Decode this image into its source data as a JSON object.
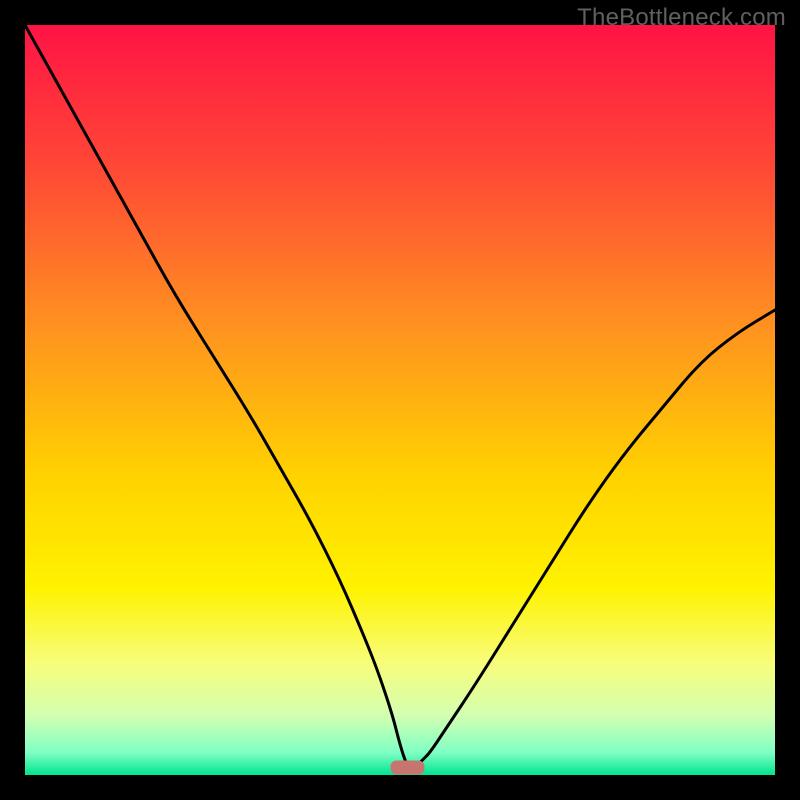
{
  "watermark": "TheBottleneck.com",
  "chart_data": {
    "type": "line",
    "title": "",
    "xlabel": "",
    "ylabel": "",
    "xlim": [
      0,
      100
    ],
    "ylim": [
      0,
      100
    ],
    "series": [
      {
        "name": "bottleneck-curve",
        "x": [
          0,
          5,
          10,
          15,
          20,
          25,
          30,
          34,
          38,
          42,
          45,
          47,
          49,
          50,
          51,
          52,
          53,
          54,
          56,
          60,
          65,
          70,
          75,
          80,
          85,
          90,
          95,
          100
        ],
        "values": [
          100,
          91,
          82,
          73,
          64,
          56,
          48,
          41,
          34,
          26,
          19,
          14,
          8,
          4,
          1,
          1,
          2,
          3,
          6,
          12,
          20,
          28,
          36,
          43,
          49,
          55,
          59,
          62
        ]
      }
    ],
    "marker": {
      "x": 51,
      "y": 1,
      "color": "#c6766e"
    },
    "background_gradient": {
      "stops": [
        {
          "offset": 0.0,
          "color": "#ff1345"
        },
        {
          "offset": 0.2,
          "color": "#ff4b35"
        },
        {
          "offset": 0.4,
          "color": "#ff9120"
        },
        {
          "offset": 0.6,
          "color": "#ffd200"
        },
        {
          "offset": 0.75,
          "color": "#fff200"
        },
        {
          "offset": 0.85,
          "color": "#f7fd7a"
        },
        {
          "offset": 0.92,
          "color": "#d4ffb0"
        },
        {
          "offset": 0.97,
          "color": "#7fffc4"
        },
        {
          "offset": 1.0,
          "color": "#00e58f"
        }
      ]
    }
  }
}
